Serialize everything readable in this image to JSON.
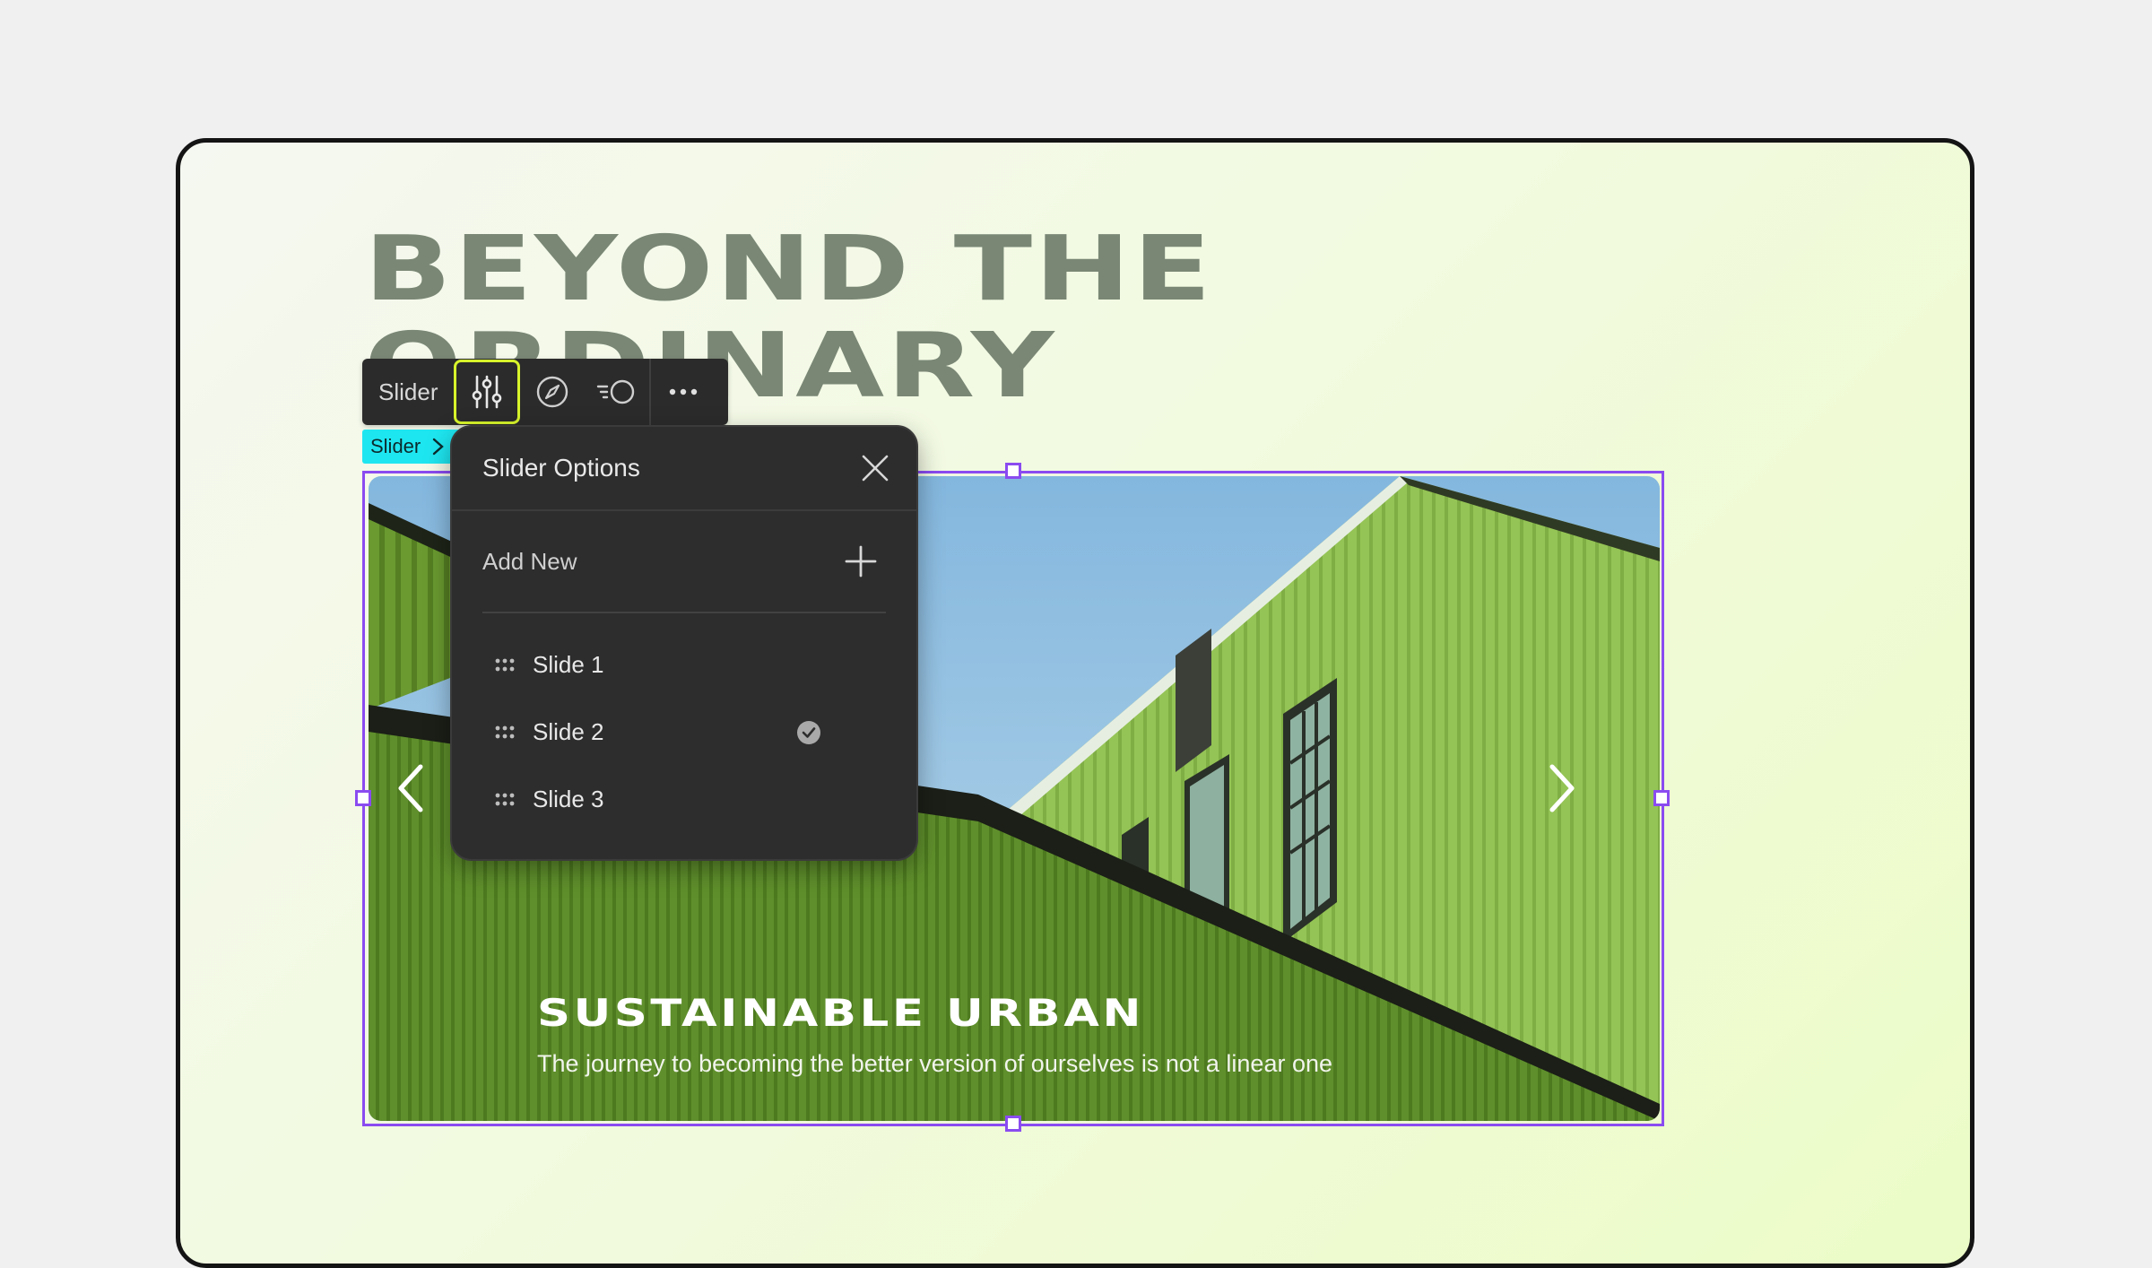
{
  "hero": {
    "title_line1": "BEYOND THE",
    "title_line2": "ORDINARY"
  },
  "toolbar": {
    "label": "Slider",
    "buttons": [
      "sliders-settings-icon",
      "compass-icon",
      "motion-icon",
      "more-icon"
    ]
  },
  "breadcrumb": {
    "label": "Slider"
  },
  "panel": {
    "title": "Slider Options",
    "add_new_label": "Add New",
    "slides": [
      {
        "label": "Slide 1",
        "selected": false
      },
      {
        "label": "Slide 2",
        "selected": true
      },
      {
        "label": "Slide 3",
        "selected": false
      }
    ]
  },
  "slide": {
    "title": "SUSTAINABLE URBAN",
    "subtitle": "The journey to becoming the better version of ourselves is not a linear one"
  },
  "colors": {
    "selection": "#8a4bf0",
    "active_highlight": "#d8f52b",
    "breadcrumb_bg": "#1ee6f0",
    "panel_bg": "#2d2d2d",
    "title_color": "#7a8775"
  }
}
